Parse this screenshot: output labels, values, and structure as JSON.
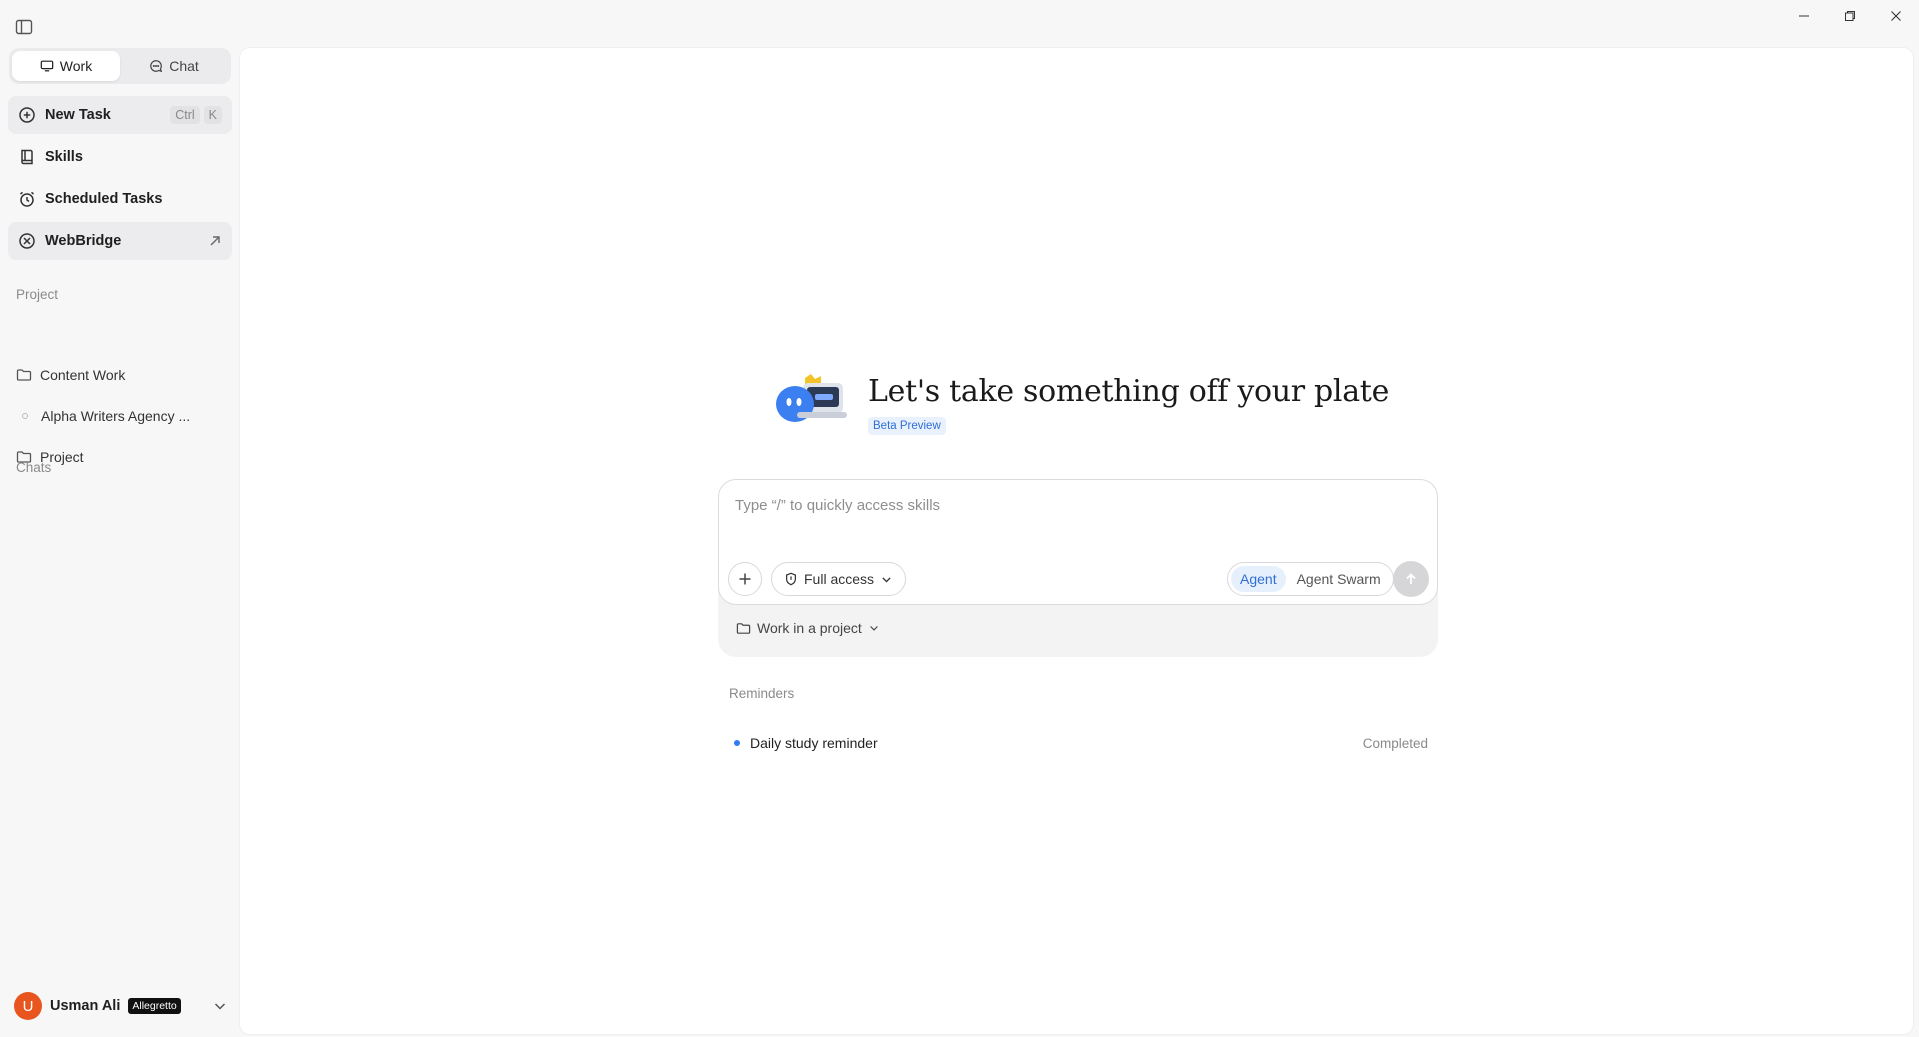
{
  "sidebar": {
    "tabs": [
      {
        "label": "Work",
        "icon": "monitor-icon"
      },
      {
        "label": "Chat",
        "icon": "chat-bubble-icon"
      }
    ],
    "nav": {
      "new_task": {
        "label": "New Task",
        "shortcut": [
          "Ctrl",
          "K"
        ]
      },
      "skills": {
        "label": "Skills"
      },
      "scheduled": {
        "label": "Scheduled Tasks"
      },
      "webbridge": {
        "label": "WebBridge"
      }
    },
    "project_section": "Project",
    "projects": [
      {
        "label": "Content Work",
        "icon": "folder-icon"
      },
      {
        "label": "Alpha Writers Agency ...",
        "icon": "dot-icon"
      },
      {
        "label": "Project",
        "icon": "folder-icon"
      }
    ],
    "chats_section": "Chats",
    "user": {
      "initial": "U",
      "name": "Usman Ali",
      "plan": "Allegretto"
    }
  },
  "main": {
    "hero_title": "Let's take something off your plate",
    "badge": "Beta Preview",
    "composer": {
      "placeholder": "Type “/” to quickly access skills",
      "access_label": "Full access",
      "modes": [
        "Agent",
        "Agent Swarm"
      ],
      "project_select": "Work in a project"
    },
    "reminders": {
      "label": "Reminders",
      "items": [
        {
          "title": "Daily study reminder",
          "status": "Completed"
        }
      ]
    }
  },
  "colors": {
    "accent": "#2f6fd6",
    "avatar": "#e8551f",
    "reminder_dot": "#2f7bf0"
  }
}
